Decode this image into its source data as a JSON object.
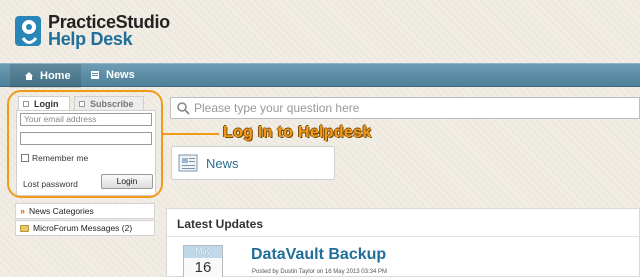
{
  "header": {
    "logo_line1": "PracticeStudio",
    "logo_line2": "Help Desk"
  },
  "nav": {
    "items": [
      {
        "label": "Home",
        "icon": "home-icon",
        "active": true
      },
      {
        "label": "News",
        "icon": "news-icon",
        "active": false
      }
    ]
  },
  "login": {
    "tabs": [
      {
        "label": "Login",
        "active": true
      },
      {
        "label": "Subscribe",
        "active": false
      }
    ],
    "email_placeholder": "Your email address",
    "password_value": "",
    "remember_label": "Remember me",
    "lost_password_label": "Lost password",
    "login_button_label": "Login"
  },
  "left_list": {
    "items": [
      {
        "label": "News Categories",
        "icon": "chevron-right-icon"
      },
      {
        "label": "MicroForum Messages (2)",
        "icon": "folder-icon"
      }
    ]
  },
  "search": {
    "placeholder": "Please type your question here"
  },
  "annotation": {
    "text": "Log In to Helpdesk",
    "color": "#f29b1b"
  },
  "news_box": {
    "label": "News"
  },
  "latest": {
    "title": "Latest Updates",
    "post": {
      "month": "May",
      "day": "16",
      "title": "DataVault Backup",
      "meta": "Posted by Dustin Taylor on 16 May 2013 03:34 PM"
    }
  },
  "colors": {
    "nav_bar": "#5f8fa8",
    "link_blue": "#1f6f9a",
    "accent_orange": "#f29b1b"
  }
}
